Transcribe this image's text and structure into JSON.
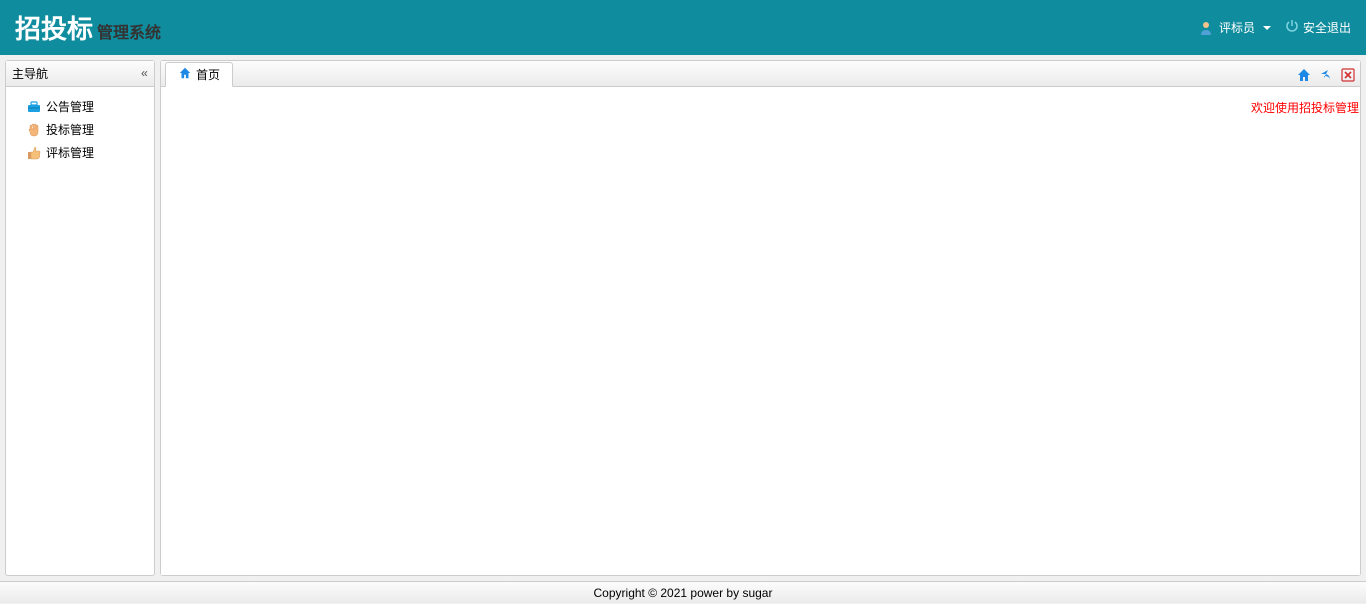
{
  "header": {
    "logo_main": "招投标",
    "logo_sub": "管理系统",
    "user_label": "评标员",
    "logout_label": "安全退出"
  },
  "sidebar": {
    "title": "主导航",
    "items": [
      {
        "label": "公告管理"
      },
      {
        "label": "投标管理"
      },
      {
        "label": "评标管理"
      }
    ]
  },
  "main": {
    "tabs": [
      {
        "label": "首页"
      }
    ],
    "welcome_text": "欢迎使用招投标管理系统"
  },
  "footer": {
    "text": "Copyright © 2021 power by sugar"
  }
}
